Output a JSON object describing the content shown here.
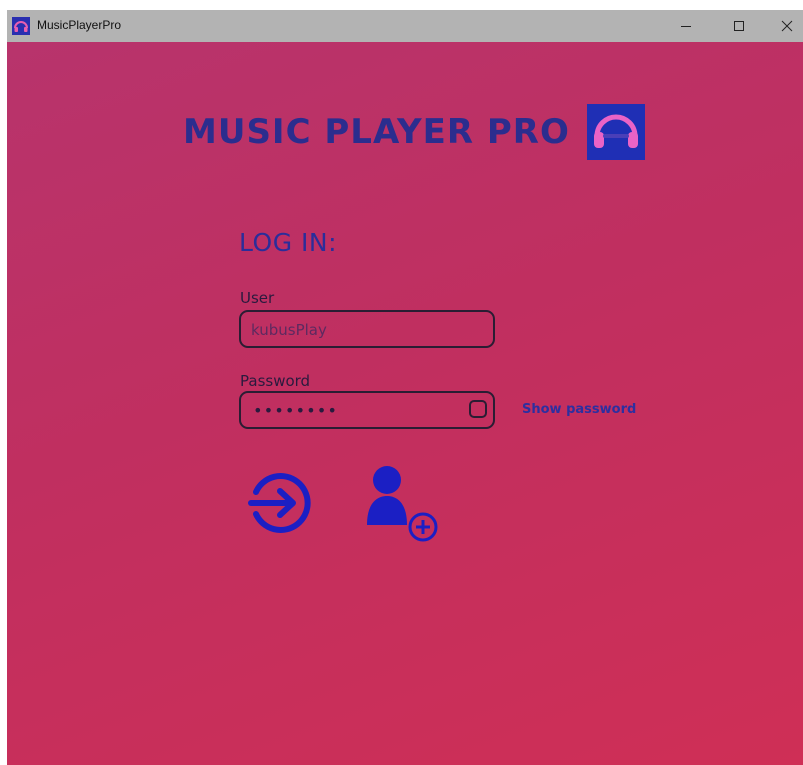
{
  "window": {
    "title": "MusicPlayerPro"
  },
  "header": {
    "app_heading": "MUSIC PLAYER PRO"
  },
  "login": {
    "heading": "LOG IN:",
    "user_label": "User",
    "user_value": "kubusPlay",
    "password_label": "Password",
    "password_masked": "••••••••",
    "show_password_label": "Show password"
  },
  "icons": {
    "app_icon": "headphones-icon",
    "logo": "headphones-logo-icon",
    "login": "sign-in-arrow-icon",
    "register": "add-user-icon"
  },
  "colors": {
    "background_start": "#b7346d",
    "background_end": "#cf2f56",
    "accent": "#2b2d9a",
    "titlebar": "#b3b3b3"
  }
}
